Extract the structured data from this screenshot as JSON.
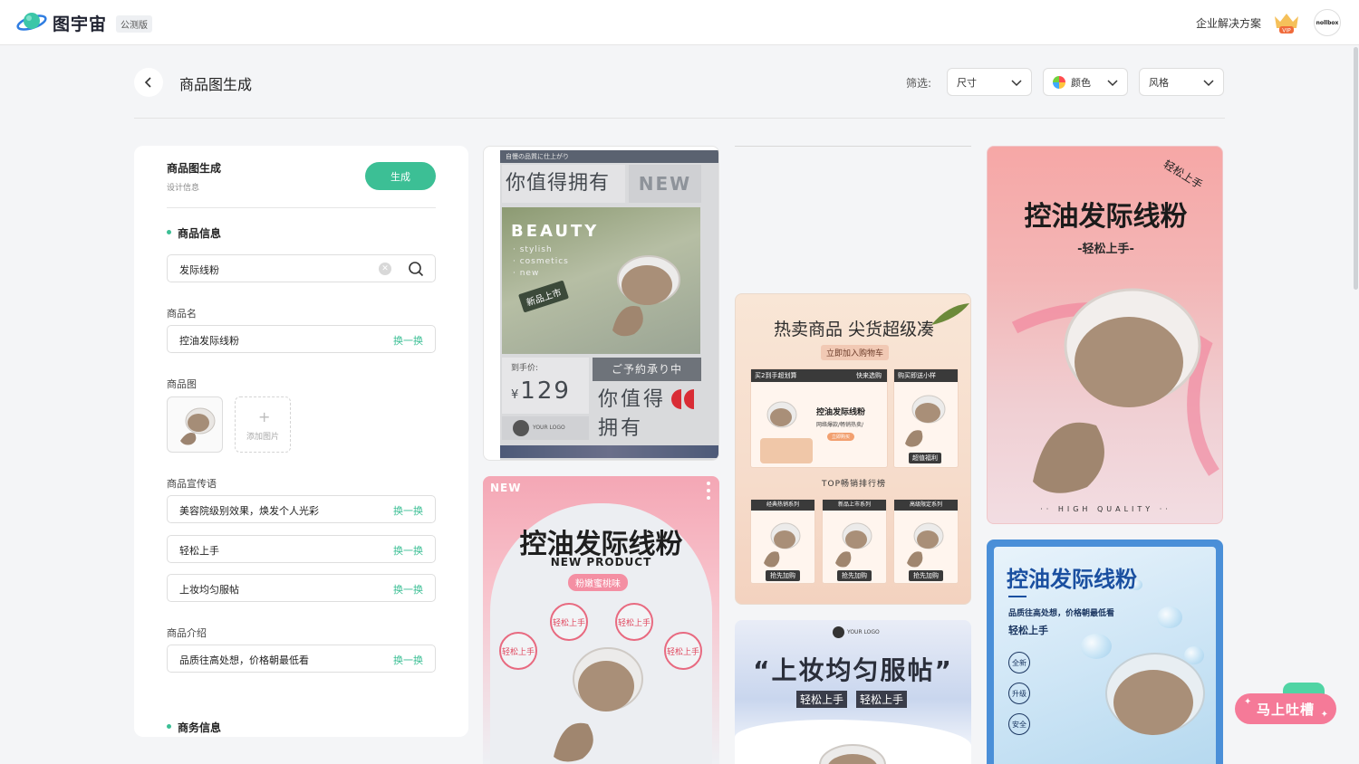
{
  "app": {
    "logo_text": "图宇宙",
    "beta_label": "公测版",
    "enterprise_label": "企业解决方案",
    "vip_label": "VIP",
    "avatar_text": "nollbox"
  },
  "header": {
    "title": "商品图生成",
    "filter_label": "筛选:",
    "filters": {
      "size": "尺寸",
      "color": "颜色",
      "style": "风格"
    }
  },
  "panel": {
    "title": "商品图生成",
    "subtitle": "设计信息",
    "generate_label": "生成",
    "product_section": "商品信息",
    "search_value": "发际线粉",
    "name_label": "商品名",
    "name_value": "控油发际线粉",
    "swap_label": "换一换",
    "image_label": "商品图",
    "add_image_label": "添加图片",
    "slogan_label": "商品宣传语",
    "slogans": [
      "美容院级别效果，焕发个人光彩",
      "轻松上手",
      "上妆均匀服帖"
    ],
    "intro_label": "商品介绍",
    "intro_value": "品质往高处想，价格朝最低看",
    "business_section": "商务信息"
  },
  "cards": {
    "c1": {
      "band": "自慢の品質に仕上がり",
      "headline": "你值得拥有",
      "new": "NEW",
      "beauty": "BEAUTY",
      "lines": [
        "· stylish",
        "· cosmetics",
        "· new"
      ],
      "tag": "新品上市",
      "price_label": "到手价:",
      "currency": "¥",
      "price": "129",
      "jp": "ご予約承り中",
      "big_line1": "你值得",
      "big_line2": "拥有",
      "logo_text": "YOUR LOGO"
    },
    "c2": {
      "new": "NEW",
      "title": "控油发际线粉",
      "sub": "NEW PRODUCT",
      "flavor": "粉嫩蜜桃味",
      "stamp": "轻松上手"
    },
    "c3": {
      "title": "热卖商品 尖货超级凑",
      "pill": "立即加入购物车",
      "hd_left": "买2到手超划算",
      "hd_right": "快来选购",
      "hd_small": "购买即送小样",
      "product_name": "控油发际线粉",
      "product_desc": "网络爆款/畅销热卖/",
      "product_tag": "立即购买",
      "benefit": "超值福利",
      "rank": "TOP畅销排行榜",
      "series": [
        "经典热销系列",
        "新品上市系列",
        "高级限定系列"
      ],
      "buy": "抢先加购"
    },
    "c4": {
      "logo_text": "YOUR LOGO",
      "quote": "“上妆均匀服帖”",
      "chip": "轻松上手"
    },
    "c5": {
      "easy": "轻松上手",
      "title": "控油发际线粉",
      "sub": "-轻松上手-",
      "hq": "·· HIGH QUALITY ··"
    },
    "c6": {
      "title": "控油发际线粉",
      "desc": "品质往高处想，价格朝最低看",
      "easy": "轻松上手",
      "badges": [
        "全新",
        "升级",
        "安全"
      ]
    }
  },
  "feedback_label": "马上吐槽"
}
